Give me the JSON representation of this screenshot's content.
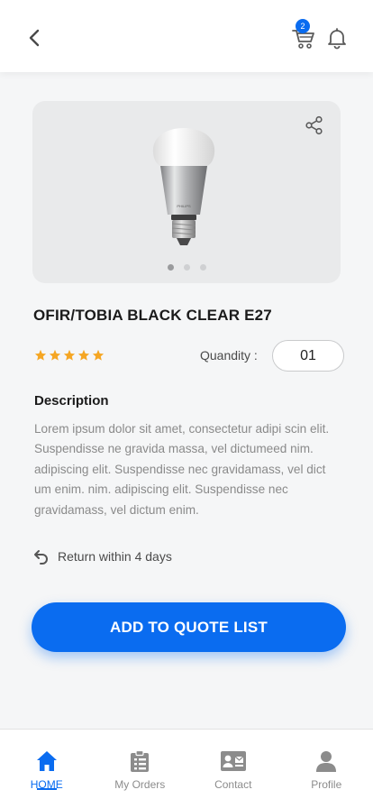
{
  "header": {
    "cart_badge": "2"
  },
  "product": {
    "title": "OFIR/TOBIA BLACK CLEAR E27",
    "image_brand_text": "PHILIPS",
    "rating": 5,
    "quantity_label": "Quandity :",
    "quantity_value": "01",
    "carousel": {
      "slide_count": 3,
      "active_index": 0
    }
  },
  "description": {
    "heading": "Description",
    "body": "Lorem ipsum dolor sit amet, consectetur adipi scin elit. Suspendisse ne gravida massa, vel dictumeed nim. adipiscing elit. Suspendisse nec gravidamass, vel dict um enim.  nim. adipiscing elit. Suspendisse nec gravidamass, vel dictum enim."
  },
  "return_policy": {
    "text": "Return within 4 days"
  },
  "cta": {
    "label": "ADD TO QUOTE LIST"
  },
  "bottom_nav": {
    "items": [
      {
        "label": "HOME",
        "icon": "home-icon",
        "active": true
      },
      {
        "label": "My Orders",
        "icon": "orders-icon",
        "active": false
      },
      {
        "label": "Contact",
        "icon": "contact-icon",
        "active": false
      },
      {
        "label": "Profile",
        "icon": "profile-icon",
        "active": false
      }
    ]
  },
  "colors": {
    "accent": "#0a6cf0",
    "star": "#f5a623",
    "background": "#f5f6f7"
  }
}
